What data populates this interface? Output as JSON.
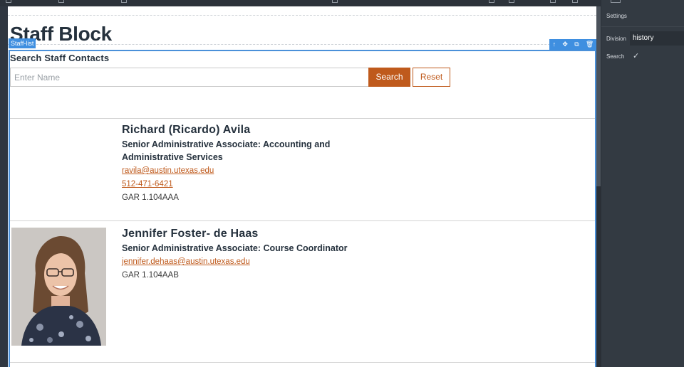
{
  "page": {
    "title": "Staff Block"
  },
  "block": {
    "label": "Staff-list"
  },
  "block_tools": {
    "up": "↑",
    "move": "✥",
    "copy": "⧉",
    "delete": "🗑"
  },
  "search": {
    "heading": "Search Staff Contacts",
    "placeholder": "Enter Name",
    "value": "",
    "search_label": "Search",
    "reset_label": "Reset"
  },
  "staff": [
    {
      "name": "Richard (Ricardo) Avila",
      "title": "Senior Administrative Associate: Accounting and Administrative Services",
      "email": "ravila@austin.utexas.edu",
      "phone": "512-471-6421",
      "office": "GAR 1.104AAA",
      "has_photo": false
    },
    {
      "name": "Jennifer Foster- de Haas",
      "title": "Senior Administrative Associate: Course Coordinator",
      "email": "jennifer.dehaas@austin.utexas.edu",
      "office": "GAR 1.104AAB",
      "has_photo": true
    }
  ],
  "settings": {
    "title": "Settings",
    "division_label": "Division",
    "division_value": "history",
    "search_label": "Search",
    "search_checked": true
  },
  "colors": {
    "accent": "#bf5a1c",
    "selection": "#4a90d9",
    "panel": "#333a42"
  },
  "icons": {
    "up": "arrow-up-icon",
    "move": "move-icon",
    "copy": "copy-icon",
    "delete": "trash-icon",
    "check": "checkmark-icon"
  }
}
